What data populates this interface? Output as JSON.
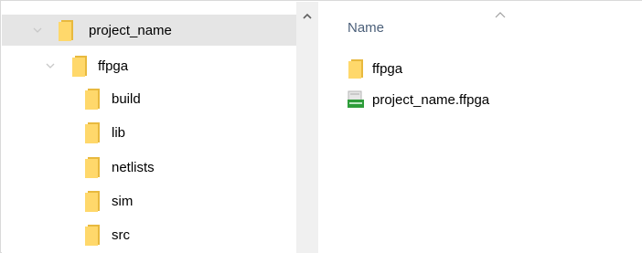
{
  "navigation_tree": {
    "items": [
      {
        "label": "project_name",
        "level": 0,
        "expanded": true,
        "selected": true
      },
      {
        "label": "ffpga",
        "level": 1,
        "expanded": true,
        "selected": false
      },
      {
        "label": "build",
        "level": 2,
        "selected": false
      },
      {
        "label": "lib",
        "level": 2,
        "selected": false
      },
      {
        "label": "netlists",
        "level": 2,
        "selected": false
      },
      {
        "label": "sim",
        "level": 2,
        "selected": false
      },
      {
        "label": "src",
        "level": 2,
        "selected": false
      }
    ]
  },
  "file_list": {
    "column_header": "Name",
    "sort": "ascending",
    "items": [
      {
        "label": "ffpga",
        "type": "folder",
        "icon": "folder-icon"
      },
      {
        "label": "project_name.ffpga",
        "type": "file",
        "icon": "ffpga-file-icon"
      }
    ]
  },
  "colors": {
    "folder": "#ffd86b",
    "folder_dark": "#e8b93e",
    "selected_bg": "#e5e5e5",
    "header_text": "#4c607a"
  }
}
